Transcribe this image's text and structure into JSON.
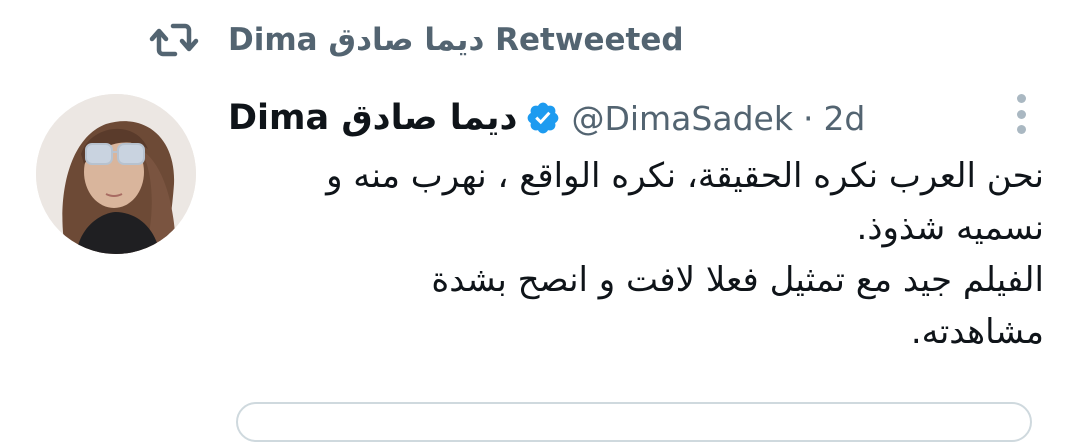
{
  "retweet": {
    "text": "Dima ديما صادق Retweeted",
    "icon": "retweet-icon"
  },
  "tweet": {
    "author": {
      "display_name": "Dima ديما صادق",
      "verified": true,
      "verified_color": "#1d9bf0",
      "handle": "@DimaSadek",
      "separator": "·",
      "time": "2d",
      "avatar_icon": "avatar-photo"
    },
    "text_lines": [
      "نحن العرب نكره الحقيقة، نكره الواقع ، نهرب منه و",
      "نسميه شذوذ.",
      "الفيلم جيد مع تمثيل فعلا لافت و انصح بشدة",
      "مشاهدته."
    ],
    "more_icon": "more-options-icon"
  },
  "colors": {
    "text_primary": "#0f1419",
    "text_secondary": "#536471",
    "accent_verified": "#1d9bf0",
    "border": "#cfd9de"
  }
}
